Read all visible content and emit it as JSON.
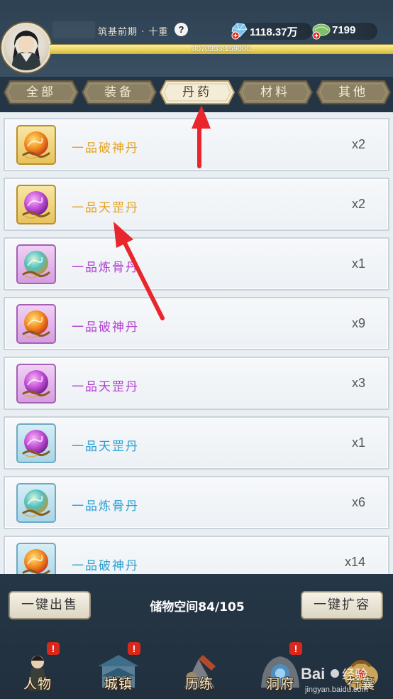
{
  "header": {
    "realm": "筑基前期 · 十重",
    "spirit_stones": "1118.37万",
    "lotus_count": "7199",
    "exp_text": "8070333/159000",
    "exp_fraction": 1.0
  },
  "tabs": [
    {
      "label": "全部",
      "active": false
    },
    {
      "label": "装备",
      "active": false
    },
    {
      "label": "丹药",
      "active": true
    },
    {
      "label": "材料",
      "active": false
    },
    {
      "label": "其他",
      "active": false
    }
  ],
  "items": [
    {
      "name": "一品破神丹",
      "qty": "x2",
      "name_color": "#e4a21f",
      "frame": "gold",
      "orb": "fire"
    },
    {
      "name": "一品天罡丹",
      "qty": "x2",
      "name_color": "#e4a21f",
      "frame": "gold",
      "orb": "violet"
    },
    {
      "name": "一品炼骨丹",
      "qty": "x1",
      "name_color": "#b33fd0",
      "frame": "purple",
      "orb": "teal"
    },
    {
      "name": "一品破神丹",
      "qty": "x9",
      "name_color": "#b33fd0",
      "frame": "purple",
      "orb": "fire"
    },
    {
      "name": "一品天罡丹",
      "qty": "x3",
      "name_color": "#b33fd0",
      "frame": "purple",
      "orb": "violet"
    },
    {
      "name": "一品天罡丹",
      "qty": "x1",
      "name_color": "#2a9fd0",
      "frame": "blue",
      "orb": "violet"
    },
    {
      "name": "一品炼骨丹",
      "qty": "x6",
      "name_color": "#2a9fd0",
      "frame": "blue",
      "orb": "teal"
    },
    {
      "name": "一品破神丹",
      "qty": "x14",
      "name_color": "#2a9fd0",
      "frame": "blue",
      "orb": "fire"
    }
  ],
  "bottom": {
    "sell_label": "一键出售",
    "storage_text": "储物空间84/105",
    "expand_label": "一键扩容"
  },
  "nav": [
    {
      "label": "人物",
      "badge": "!"
    },
    {
      "label": "城镇",
      "badge": "!"
    },
    {
      "label": "历练",
      "badge": ""
    },
    {
      "label": "洞府",
      "badge": "!"
    },
    {
      "label": "行囊",
      "badge": ""
    }
  ],
  "watermark": "Bai经验 jingyan.baidu.com",
  "colors": {
    "annotation_arrow": "#e8262c",
    "rarity_gold": "#e4a21f",
    "rarity_purple": "#b33fd0",
    "rarity_blue": "#2a9fd0"
  }
}
